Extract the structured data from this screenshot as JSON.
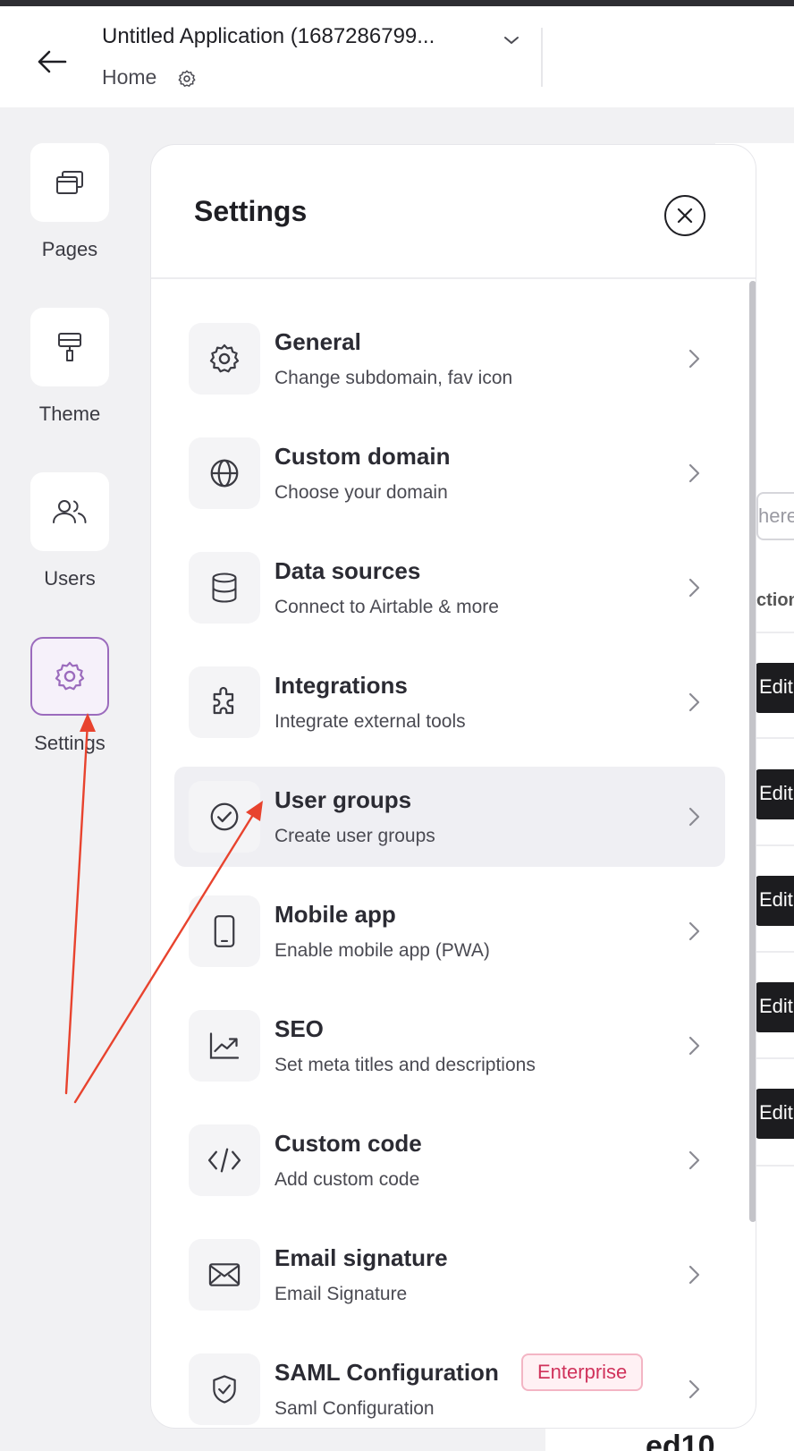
{
  "header": {
    "app_title": "Untitled Application (1687286799...",
    "breadcrumb": "Home"
  },
  "sidebar": {
    "items": [
      {
        "label": "Pages",
        "icon": "pages-icon",
        "active": false
      },
      {
        "label": "Theme",
        "icon": "paint-roller-icon",
        "active": false
      },
      {
        "label": "Users",
        "icon": "users-icon",
        "active": false
      },
      {
        "label": "Settings",
        "icon": "gear-icon",
        "active": true
      }
    ]
  },
  "settings": {
    "title": "Settings",
    "items": [
      {
        "label": "General",
        "description": "Change subdomain, fav icon",
        "icon": "gear-icon"
      },
      {
        "label": "Custom domain",
        "description": "Choose your domain",
        "icon": "globe-icon"
      },
      {
        "label": "Data sources",
        "description": "Connect to Airtable & more",
        "icon": "database-icon"
      },
      {
        "label": "Integrations",
        "description": "Integrate external tools",
        "icon": "puzzle-icon"
      },
      {
        "label": "User groups",
        "description": "Create user groups",
        "icon": "check-circle-icon",
        "highlighted": true
      },
      {
        "label": "Mobile app",
        "description": "Enable mobile app (PWA)",
        "icon": "smartphone-icon"
      },
      {
        "label": "SEO",
        "description": "Set meta titles and descriptions",
        "icon": "trending-up-icon"
      },
      {
        "label": "Custom code",
        "description": "Add custom code",
        "icon": "code-icon"
      },
      {
        "label": "Email signature",
        "description": "Email Signature",
        "icon": "envelope-icon"
      },
      {
        "label": "SAML Configuration",
        "description": "Saml Configuration",
        "icon": "shield-check-icon",
        "badge": "Enterprise"
      }
    ]
  },
  "background": {
    "search_fragment": "here",
    "column_fragment": "ction",
    "edit_label": "Edit",
    "bottom_fragment": "ed10"
  },
  "colors": {
    "accent": "#9b6bbd",
    "annotation": "#e8432e",
    "badge_text": "#d0325b"
  }
}
